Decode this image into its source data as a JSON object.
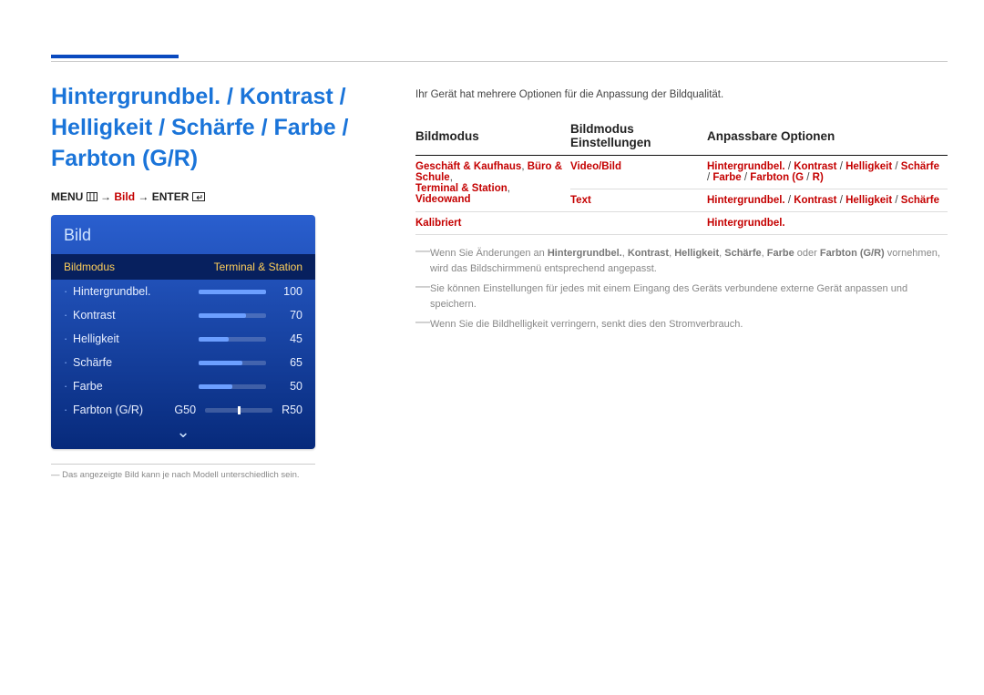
{
  "heading": "Hintergrundbel. / Kontrast / Helligkeit / Schärfe / Farbe / Farbton (G/R)",
  "breadcrumb": {
    "menu": "MENU",
    "sep1": "→",
    "mid": "Bild",
    "sep2": "→",
    "enter": "ENTER"
  },
  "osd": {
    "title": "Bild",
    "selected_label": "Bildmodus",
    "selected_value": "Terminal & Station",
    "rows": [
      {
        "name": "Hintergrundbel.",
        "value": 100
      },
      {
        "name": "Kontrast",
        "value": 70
      },
      {
        "name": "Helligkeit",
        "value": 45
      },
      {
        "name": "Schärfe",
        "value": 65
      },
      {
        "name": "Farbe",
        "value": 50
      }
    ],
    "gr_row": {
      "name": "Farbton (G/R)",
      "g": "G50",
      "r": "R50"
    }
  },
  "footnote_marker": "―",
  "footnote": "Das angezeigte Bild kann je nach Modell unterschiedlich sein.",
  "intro": "Ihr Gerät hat mehrere Optionen für die Anpassung der Bildqualität.",
  "table": {
    "headers": [
      "Bildmodus",
      "Bildmodus Einstellungen",
      "Anpassbare Optionen"
    ],
    "rows": [
      {
        "col1": "Geschäft & Kaufhaus, Büro & Schule,\nTerminal & Station, Videowand",
        "col2": "Video/Bild",
        "col3": "Hintergrundbel. / Kontrast / Helligkeit / Schärfe / Farbe / Farbton (G/R)"
      },
      {
        "col1": "",
        "col2": "Text",
        "col3": "Hintergrundbel. / Kontrast / Helligkeit / Schärfe"
      },
      {
        "col1": "Kalibriert",
        "col2": "",
        "col3": "Hintergrundbel."
      }
    ]
  },
  "notes": [
    {
      "prefix": "Wenn Sie Änderungen an ",
      "bold_parts": [
        "Hintergrundbel.",
        "Kontrast",
        "Helligkeit",
        "Schärfe",
        "Farbe",
        "Farbton (G/R)"
      ],
      "middle": " vornehmen, wird das Bildschirmmenü entsprechend angepasst."
    },
    {
      "plain": "Sie können Einstellungen für jedes mit einem Eingang des Geräts verbundene externe Gerät anpassen und speichern."
    },
    {
      "plain": "Wenn Sie die Bildhelligkeit verringern, senkt dies den Stromverbrauch."
    }
  ],
  "chart_data": {
    "type": "bar",
    "title": "Bild OSD sliders",
    "ylim": [
      0,
      100
    ],
    "categories": [
      "Hintergrundbel.",
      "Kontrast",
      "Helligkeit",
      "Schärfe",
      "Farbe"
    ],
    "values": [
      100,
      70,
      45,
      65,
      50
    ],
    "extra": {
      "Farbton_G": 50,
      "Farbton_R": 50
    }
  }
}
